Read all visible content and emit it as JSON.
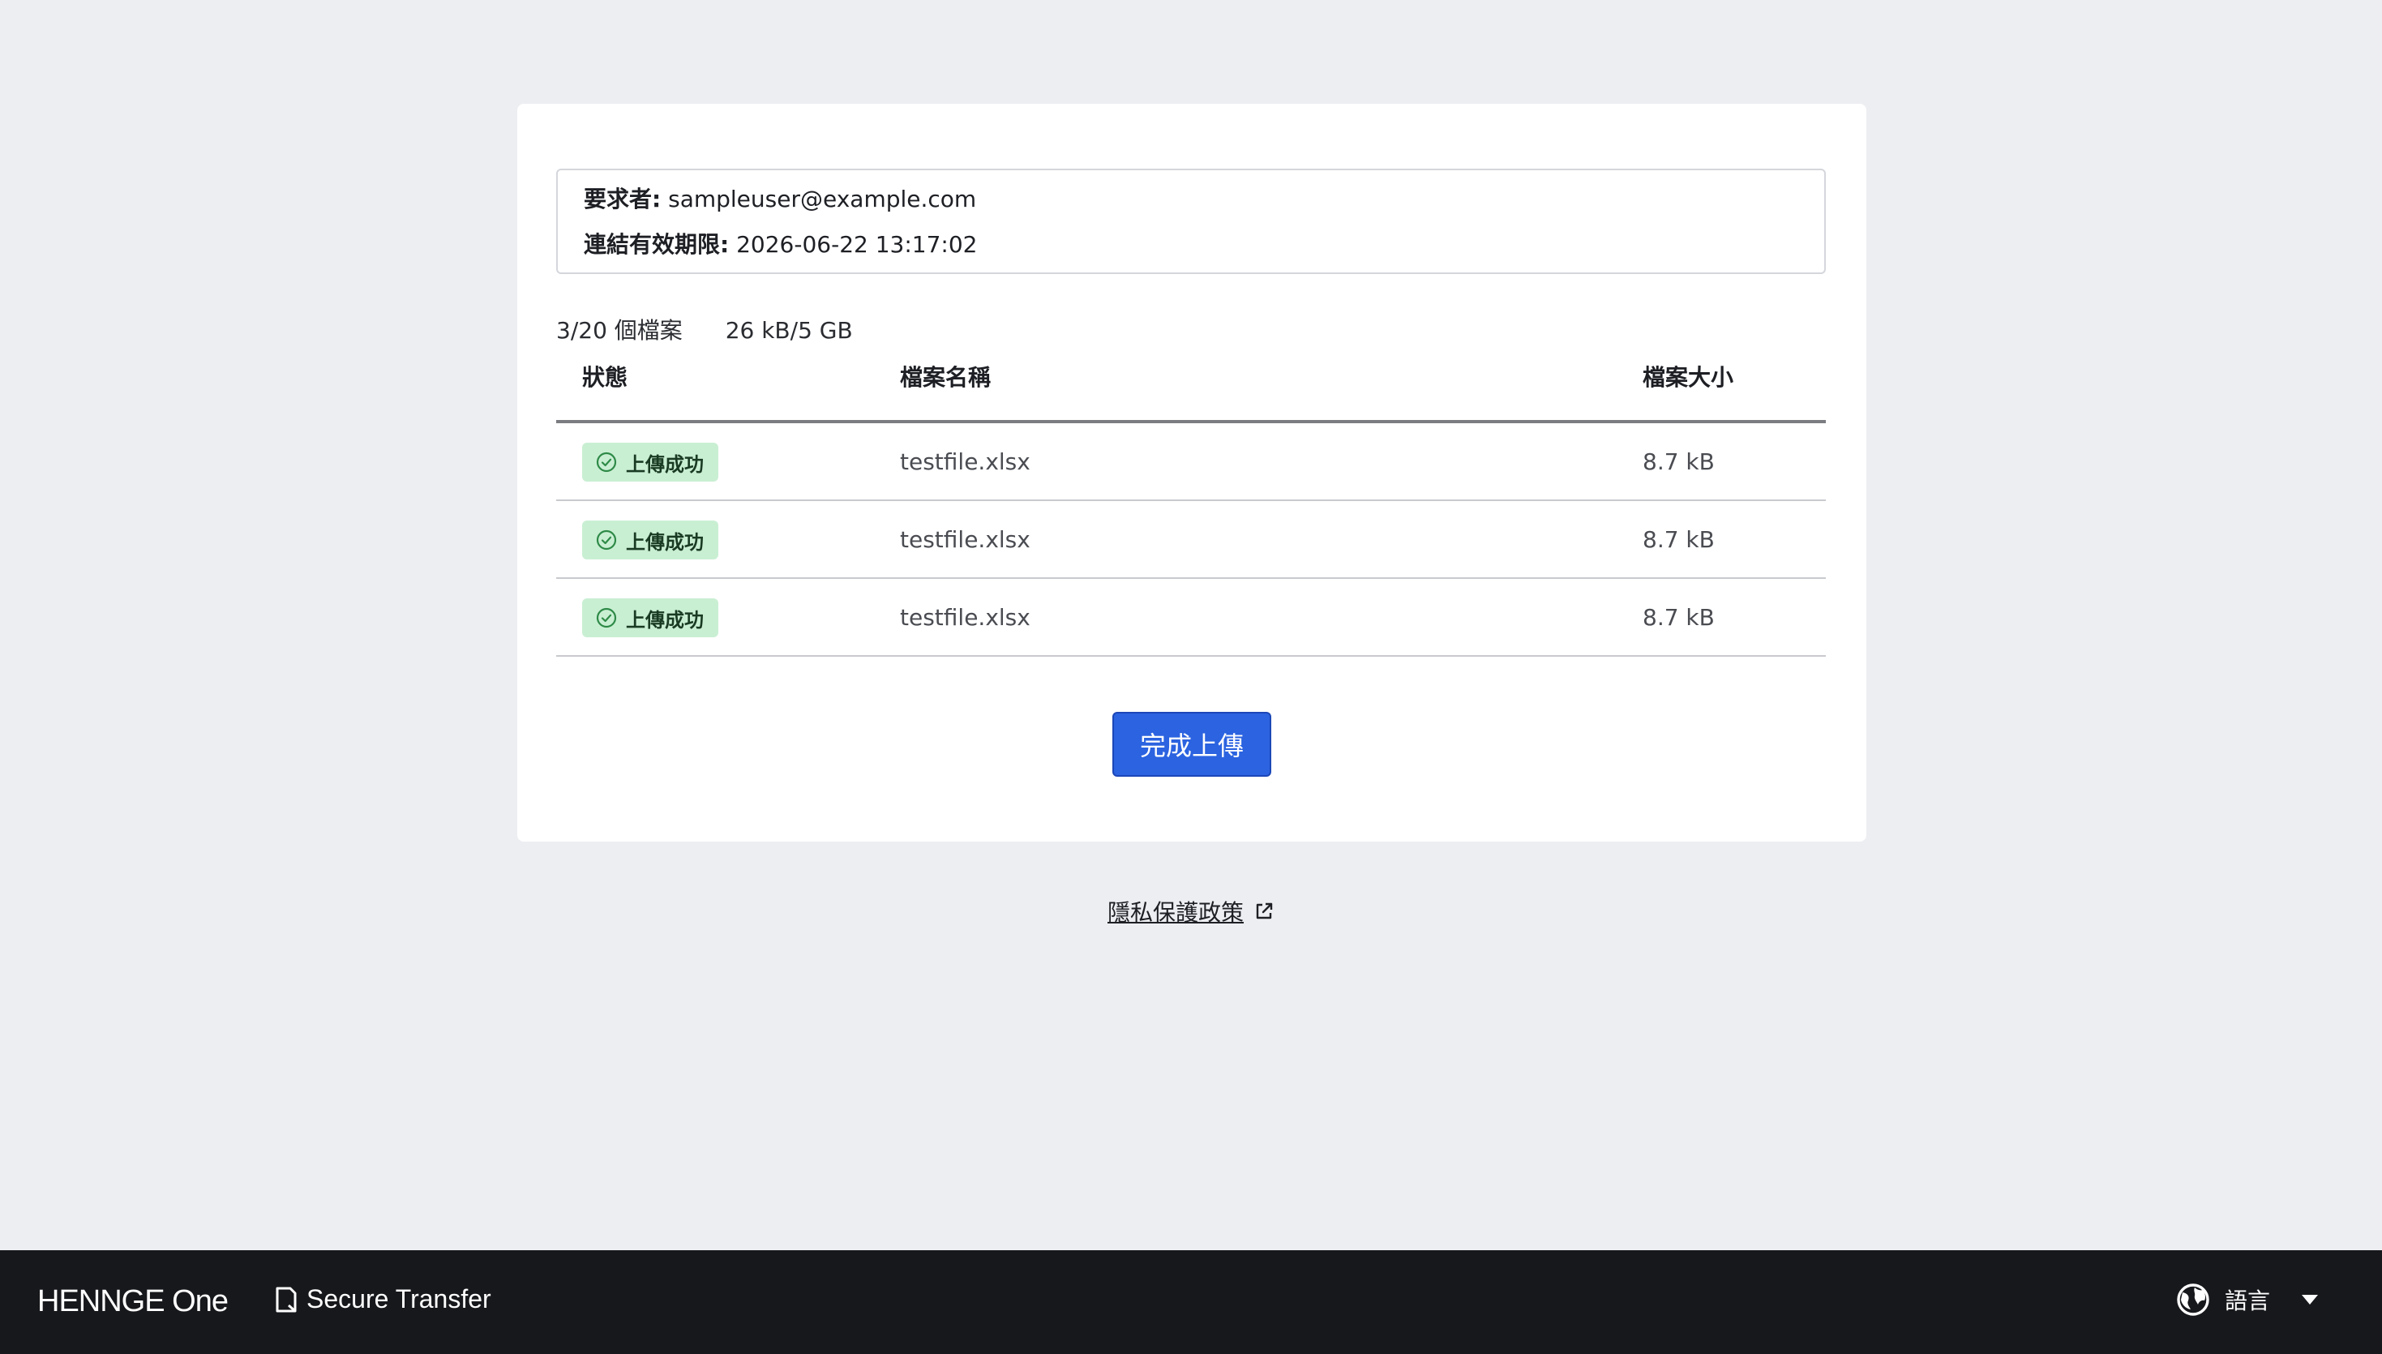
{
  "info": {
    "requester_label": "要求者:",
    "requester_value": "sampleuser@example.com",
    "expiry_label": "連結有效期限:",
    "expiry_value": "2026-06-22 13:17:02"
  },
  "summary": {
    "file_count": "3/20 個檔案",
    "total_size": "26 kB/5 GB"
  },
  "table": {
    "headers": {
      "status": "狀態",
      "name": "檔案名稱",
      "size": "檔案大小"
    },
    "rows": [
      {
        "status": "上傳成功",
        "name": "testfile.xlsx",
        "size": "8.7 kB"
      },
      {
        "status": "上傳成功",
        "name": "testfile.xlsx",
        "size": "8.7 kB"
      },
      {
        "status": "上傳成功",
        "name": "testfile.xlsx",
        "size": "8.7 kB"
      }
    ]
  },
  "actions": {
    "finish_label": "完成上傳"
  },
  "links": {
    "privacy_label": "隱私保護政策"
  },
  "footer": {
    "brand": "HENNGE One",
    "product": "Secure Transfer",
    "language_label": "語言"
  },
  "icons": {
    "status": "check-circle-icon",
    "external": "external-link-icon",
    "product": "document-icon",
    "language": "globe-icon",
    "dropdown": "caret-down-icon"
  },
  "colors": {
    "page_background": "#edeef2",
    "primary_button": "#2b63e0",
    "success_badge": "#c9efd3",
    "success_icon": "#2e8a47",
    "footer_background": "#17181c"
  }
}
